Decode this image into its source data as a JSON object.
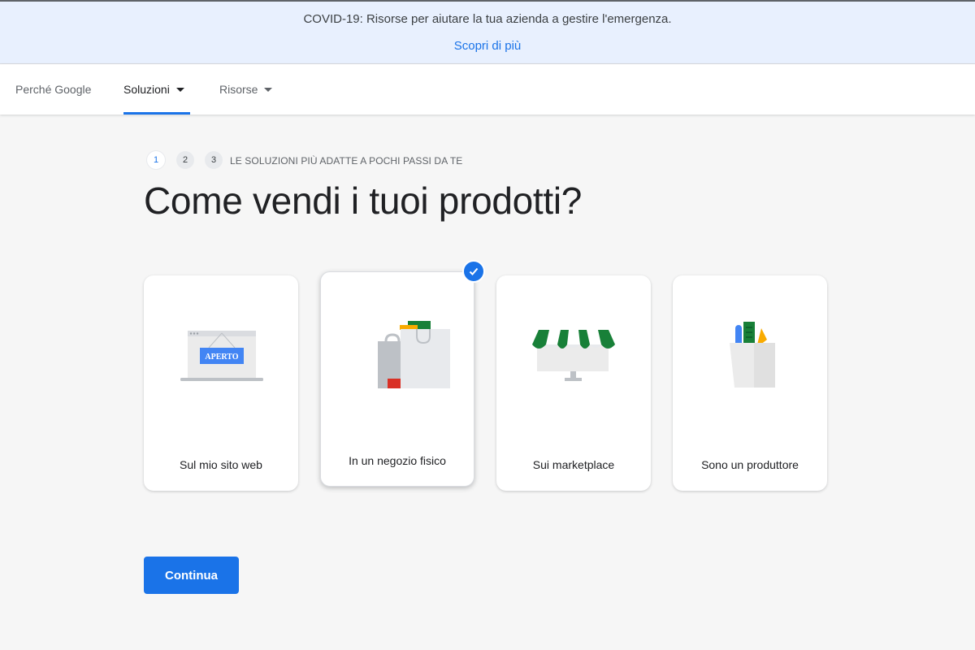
{
  "banner": {
    "text": "COVID-19: Risorse per aiutare la tua azienda a gestire l'emergenza.",
    "link": "Scopri di più"
  },
  "nav": {
    "items": [
      {
        "label": "Perché Google"
      },
      {
        "label": "Soluzioni"
      },
      {
        "label": "Risorse"
      }
    ],
    "active": "Soluzioni"
  },
  "steps": {
    "numbers": [
      "1",
      "2",
      "3"
    ],
    "label": "LE SOLUZIONI PIÙ ADATTE A POCHI PASSI DA TE"
  },
  "page_title": "Come vendi i tuoi prodotti?",
  "cards": [
    {
      "label": "Sul mio sito web",
      "icon": "laptop-open-sign-icon",
      "sign_text": "APERTO"
    },
    {
      "label": "In un negozio fisico",
      "icon": "shopping-bags-icon",
      "selected": true
    },
    {
      "label": "Sui marketplace",
      "icon": "market-stall-icon"
    },
    {
      "label": "Sono un produttore",
      "icon": "producer-bag-icon"
    }
  ],
  "continue_label": "Continua",
  "colors": {
    "accent": "#1a73e8",
    "banner_bg": "#e8f0fe",
    "page_bg": "#f6f6f6",
    "green": "#188038",
    "red": "#d93025",
    "yellow": "#f9ab00"
  }
}
